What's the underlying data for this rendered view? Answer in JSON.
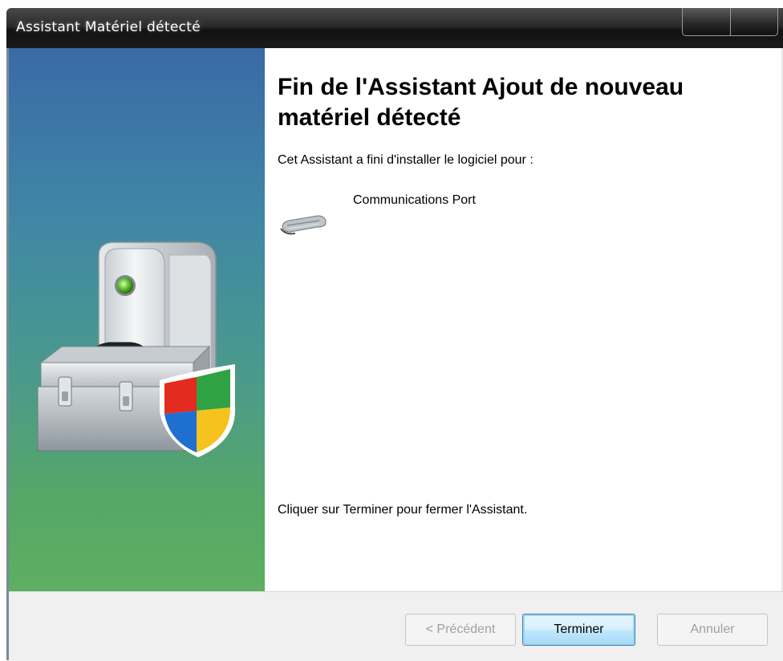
{
  "window": {
    "title": "Assistant Matériel détecté"
  },
  "content": {
    "heading": "Fin de l'Assistant Ajout de nouveau matériel détecté",
    "intro": "Cet Assistant a fini d'installer le logiciel pour :",
    "device_name": "Communications Port",
    "device_icon": "serial-port-icon",
    "finish_text": "Cliquer sur Terminer pour fermer l'Assistant."
  },
  "footer": {
    "prev_label": "< Précédent",
    "finish_label": "Terminer",
    "cancel_label": "Annuler"
  },
  "side_panel": {
    "illustration": "toolbox-computer-shield-illustration"
  },
  "colors": {
    "accent_button_border": "#3c7fb1",
    "side_panel_top": "#3a6aa6",
    "side_panel_bottom": "#5eae63"
  }
}
